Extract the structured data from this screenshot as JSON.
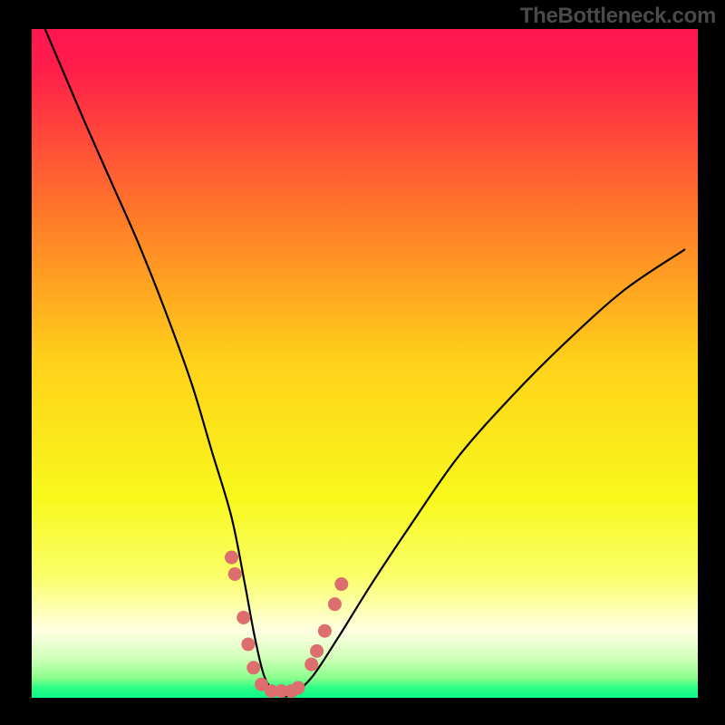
{
  "watermark": "TheBottleneck.com",
  "chart_data": {
    "type": "line",
    "title": "",
    "xlabel": "",
    "ylabel": "",
    "xlim": [
      0,
      100
    ],
    "ylim": [
      0,
      100
    ],
    "gradient_stops": [
      {
        "offset": 0.0,
        "color": "#ff1650"
      },
      {
        "offset": 0.06,
        "color": "#ff1e4a"
      },
      {
        "offset": 0.28,
        "color": "#ff7a28"
      },
      {
        "offset": 0.5,
        "color": "#ffd21a"
      },
      {
        "offset": 0.7,
        "color": "#f8f81c"
      },
      {
        "offset": 0.82,
        "color": "#faff6a"
      },
      {
        "offset": 0.9,
        "color": "#ffffe2"
      },
      {
        "offset": 0.94,
        "color": "#d2ffba"
      },
      {
        "offset": 0.97,
        "color": "#8cff8c"
      },
      {
        "offset": 0.985,
        "color": "#2bfd85"
      },
      {
        "offset": 1.0,
        "color": "#0bfa86"
      }
    ],
    "series": [
      {
        "name": "bottleneck-curve",
        "x": [
          2,
          5,
          8,
          12,
          16,
          20,
          24,
          27,
          30,
          32,
          33.5,
          35,
          37,
          39,
          42,
          46,
          51,
          57,
          64,
          72,
          80,
          89,
          98
        ],
        "y": [
          100,
          93,
          86,
          77,
          68,
          58,
          47,
          37,
          27,
          17,
          9,
          3,
          0.5,
          0.5,
          3,
          9,
          17,
          26,
          36,
          45,
          53,
          61,
          67
        ]
      }
    ],
    "markers": {
      "name": "dotted-path",
      "color": "#dd6e6e",
      "points": [
        {
          "x": 30.0,
          "y": 21
        },
        {
          "x": 30.5,
          "y": 18.5
        },
        {
          "x": 31.8,
          "y": 12
        },
        {
          "x": 32.5,
          "y": 8
        },
        {
          "x": 33.3,
          "y": 4.5
        },
        {
          "x": 34.5,
          "y": 2
        },
        {
          "x": 36.0,
          "y": 1
        },
        {
          "x": 37.5,
          "y": 1
        },
        {
          "x": 39.0,
          "y": 1
        },
        {
          "x": 40.0,
          "y": 1.5
        },
        {
          "x": 42.0,
          "y": 5
        },
        {
          "x": 42.8,
          "y": 7
        },
        {
          "x": 44.0,
          "y": 10
        },
        {
          "x": 45.5,
          "y": 14
        },
        {
          "x": 46.5,
          "y": 17
        }
      ]
    }
  }
}
